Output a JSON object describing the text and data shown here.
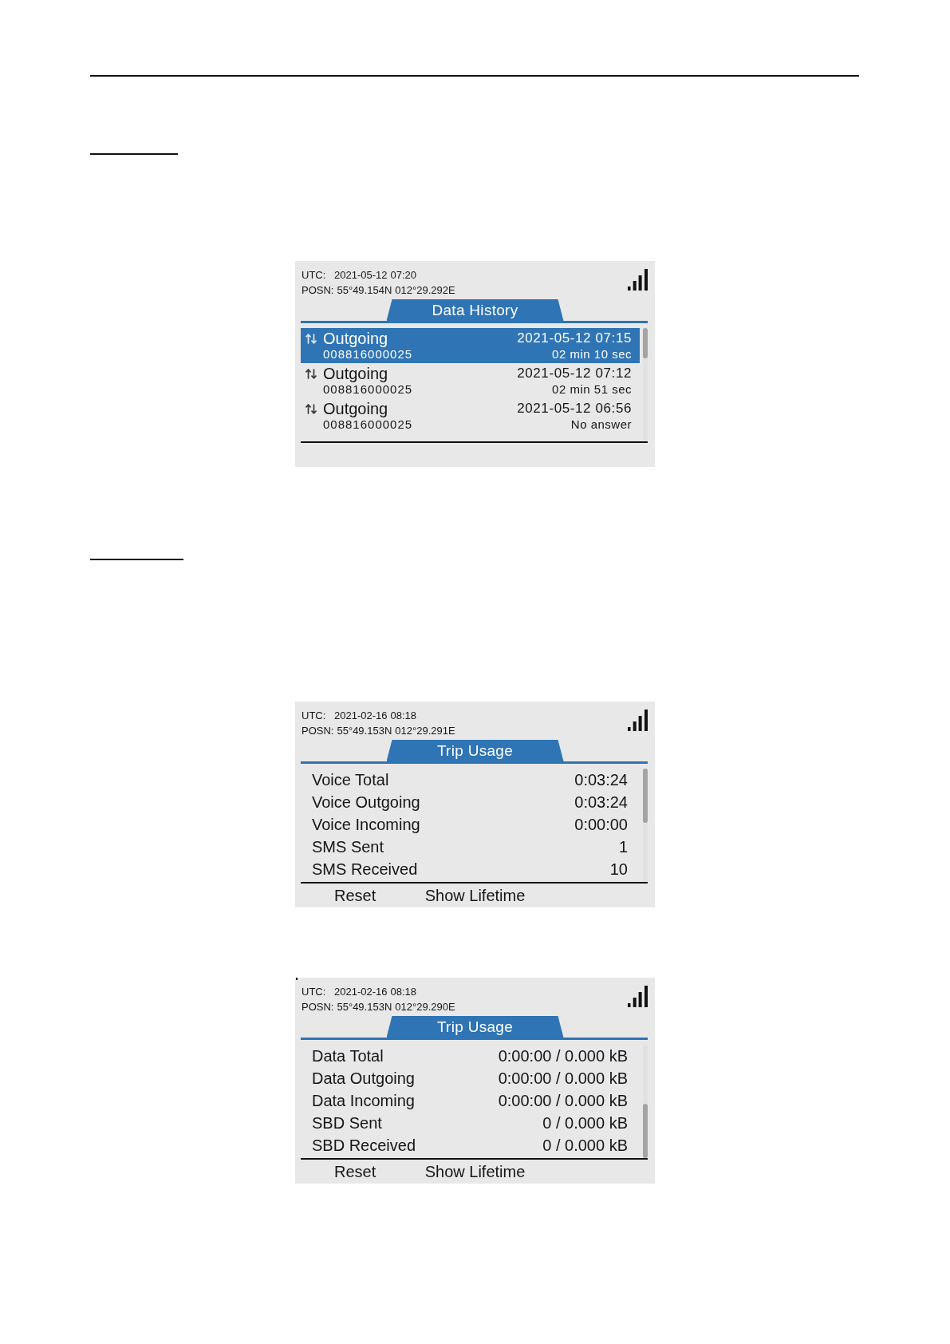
{
  "screens": [
    {
      "kind": "history",
      "status": {
        "utc_label": "UTC:",
        "utc_date": "2021-05-12",
        "utc_time": "07:20",
        "posn_label": "POSN:",
        "latitude": "55°49.154N",
        "longitude": "012°29.292E"
      },
      "title": "Data History",
      "scrolled_to_end": false,
      "rows": [
        {
          "direction": "Outgoing",
          "number": "008816000025",
          "datetime": "2021-05-12 07:15",
          "duration": "02 min 10 sec",
          "selected": true
        },
        {
          "direction": "Outgoing",
          "number": "008816000025",
          "datetime": "2021-05-12 07:12",
          "duration": "02 min 51 sec",
          "selected": false
        },
        {
          "direction": "Outgoing",
          "number": "008816000025",
          "datetime": "2021-05-12 06:56",
          "duration": "No answer",
          "selected": false
        }
      ]
    },
    {
      "kind": "usage",
      "status": {
        "utc_label": "UTC:",
        "utc_date": "2021-02-16",
        "utc_time": "08:18",
        "posn_label": "POSN:",
        "latitude": "55°49.153N",
        "longitude": "012°29.291E"
      },
      "title": "Trip Usage",
      "scrolled_to_end": false,
      "rows": [
        {
          "label": "Voice Total",
          "value": "0:03:24"
        },
        {
          "label": "Voice Outgoing",
          "value": "0:03:24"
        },
        {
          "label": "Voice Incoming",
          "value": "0:00:00"
        },
        {
          "label": "SMS Sent",
          "value": "1"
        },
        {
          "label": "SMS Received",
          "value": "10"
        }
      ],
      "softkeys": [
        "Reset",
        "Show Lifetime"
      ]
    },
    {
      "kind": "usage",
      "corner_mark": true,
      "status": {
        "utc_label": "UTC:",
        "utc_date": "2021-02-16",
        "utc_time": "08:18",
        "posn_label": "POSN:",
        "latitude": "55°49.153N",
        "longitude": "012°29.290E"
      },
      "title": "Trip Usage",
      "scrolled_to_end": true,
      "rows": [
        {
          "label": "Data Total",
          "value": "0:00:00 / 0.000 kB"
        },
        {
          "label": "Data Outgoing",
          "value": "0:00:00 / 0.000 kB"
        },
        {
          "label": "Data Incoming",
          "value": "0:00:00 / 0.000 kB"
        },
        {
          "label": "SBD Sent",
          "value": "0 / 0.000 kB"
        },
        {
          "label": "SBD Received",
          "value": "0 / 0.000 kB"
        }
      ],
      "softkeys": [
        "Reset",
        "Show Lifetime"
      ]
    }
  ]
}
